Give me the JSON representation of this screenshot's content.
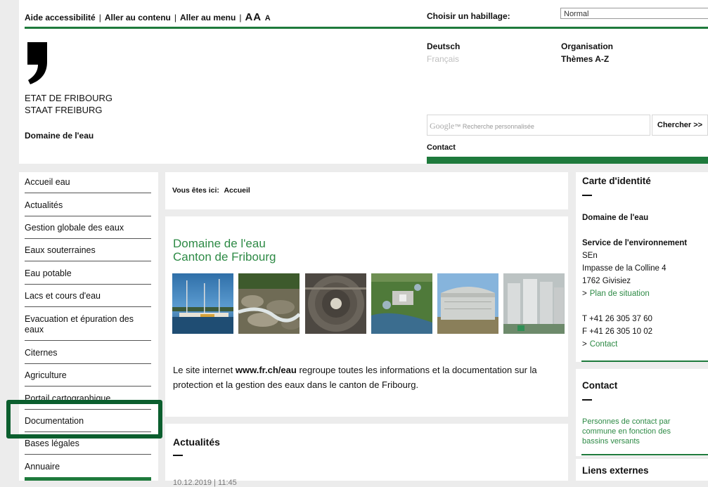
{
  "top_links": {
    "accessibility": "Aide accessibilité",
    "content": "Aller au contenu",
    "menu": "Aller au menu",
    "font_sizes": "AA",
    "font_small": "A"
  },
  "skin": {
    "label": "Choisir un habillage:",
    "selected": "Normal"
  },
  "state": {
    "line1": "ETAT DE FRIBOURG",
    "line2": "STAAT FREIBURG"
  },
  "domain": "Domaine de l'eau",
  "languages": {
    "de": "Deutsch",
    "fr": "Français"
  },
  "nav": {
    "org": "Organisation",
    "themes": "Thèmes A-Z"
  },
  "search": {
    "placeholder_brand": "Google",
    "placeholder": "Recherche personnalisée",
    "button": "Chercher >>"
  },
  "contact_link": "Contact",
  "menu": [
    "Accueil eau",
    "Actualités",
    "Gestion globale des eaux",
    "Eaux souterraines",
    "Eau potable",
    "Lacs et cours d'eau",
    "Evacuation et épuration des eaux",
    "Citernes",
    "Agriculture",
    "Portail cartographique",
    "Documentation",
    "Bases légales",
    "Annuaire"
  ],
  "breadcrumb": {
    "label": "Vous êtes ici:",
    "current": "Accueil"
  },
  "main": {
    "title_line1": "Domaine de l'eau",
    "title_line2": "Canton de Fribourg",
    "intro_before": "Le site internet ",
    "intro_link": "www.fr.ch/eau",
    "intro_after": " regroupe toutes les informations et la documentation sur la protection et la gestion des eaux dans le canton de Fribourg."
  },
  "news": {
    "title": "Actualités",
    "date": "10.12.2019 | 11:45"
  },
  "identity": {
    "title": "Carte d'identité",
    "domain": "Domaine de l'eau",
    "service": "Service de l'environnement",
    "abbr": "SEn",
    "street": "Impasse de la Colline 4",
    "city": "1762 Givisiez",
    "map_link": "Plan de situation",
    "phone": "T +41 26 305 37 60",
    "fax": "F +41 26 305 10 02",
    "contact_link": "Contact"
  },
  "contact_box": {
    "title": "Contact",
    "desc": "Personnes de contact par commune en fonction des bassins versants"
  },
  "external": {
    "title": "Liens externes"
  },
  "colors": {
    "brand_green": "#1e7a3c",
    "link_green": "#2d8a45",
    "highlight": "#0b5e2e"
  }
}
